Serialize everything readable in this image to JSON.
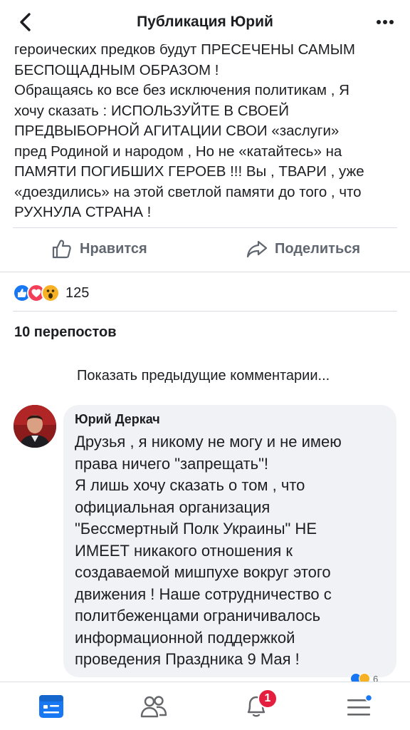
{
  "header": {
    "title": "Публикация Юрий"
  },
  "post": {
    "lines": [
      "героических предков будут ПРЕСЕЧЕНЫ САМЫМ",
      "БЕСПОЩАДНЫМ ОБРАЗОМ !",
      "Обращаясь ко все без исключения политикам , Я",
      "хочу сказать : ИСПОЛЬЗУЙТЕ В СВОЕЙ",
      "ПРЕДВЫБОРНОЙ АГИТАЦИИ СВОИ «заслуги»",
      "пред Родиной и народом , Но не «катайтесь» на",
      "ПАМЯТИ ПОГИБШИХ ГЕРОЕВ !!! Вы , ТВАРИ , уже",
      "«доездились» на этой светлой памяти до того , что",
      "РУХНУЛА СТРАНА !"
    ]
  },
  "actions": {
    "like_label": "Нравится",
    "share_label": "Поделиться"
  },
  "reactions": {
    "count": "125",
    "colors": {
      "like": "#1877f2",
      "love": "#f33e58",
      "wow": "#f7b125"
    }
  },
  "shares": {
    "label": "10 перепостов"
  },
  "comments": {
    "show_previous": "Показать предыдущие комментарии...",
    "items": [
      {
        "author": "Юрий Деркач",
        "lines": [
          "Друзья , я никому не могу и не имею",
          "права ничего \"запрещать\"!",
          "Я лишь хочу сказать о том , что",
          "официальная организация",
          "\"Бессмертный Полк Украины\" НЕ",
          "ИМЕЕТ никакого отношения к",
          "создаваемой мишпухе вокруг этого",
          "движения ! Наше сотрудничество с",
          "политбеженцами ограничивалось",
          "информационной поддержкой",
          "проведения Праздника 9 Мая !"
        ],
        "reaction_count": "6"
      }
    ]
  },
  "tabbar": {
    "notifications_badge": "1",
    "accent": "#1877f2"
  }
}
